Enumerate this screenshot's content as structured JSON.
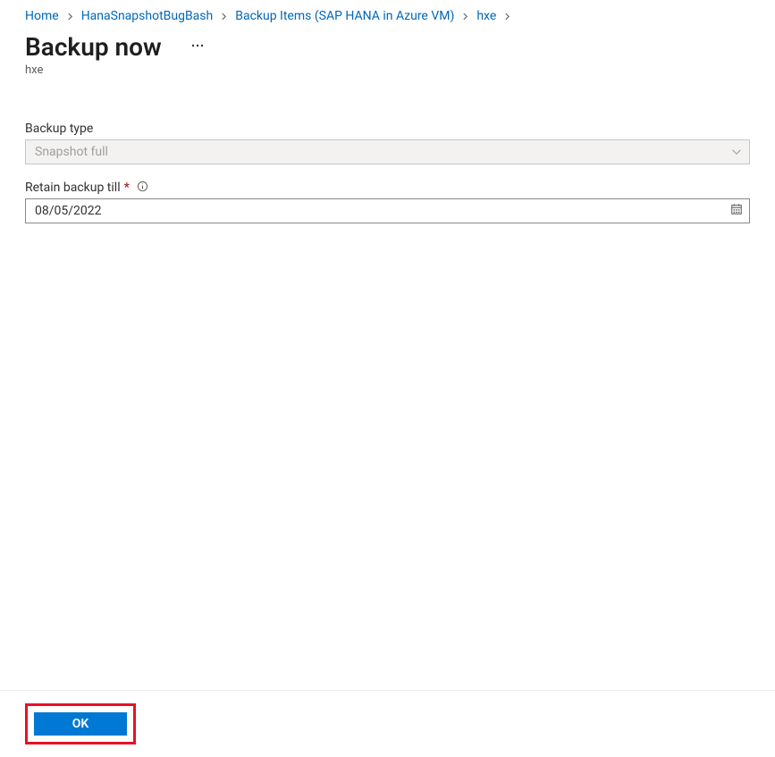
{
  "breadcrumb": {
    "items": [
      {
        "label": "Home"
      },
      {
        "label": "HanaSnapshotBugBash"
      },
      {
        "label": "Backup Items (SAP HANA in Azure VM)"
      },
      {
        "label": "hxe"
      }
    ]
  },
  "header": {
    "title": "Backup now",
    "subtitle": "hxe"
  },
  "form": {
    "backup_type": {
      "label": "Backup type",
      "value": "Snapshot full"
    },
    "retain_till": {
      "label": "Retain backup till",
      "value": "08/05/2022"
    }
  },
  "footer": {
    "ok_label": "OK"
  }
}
